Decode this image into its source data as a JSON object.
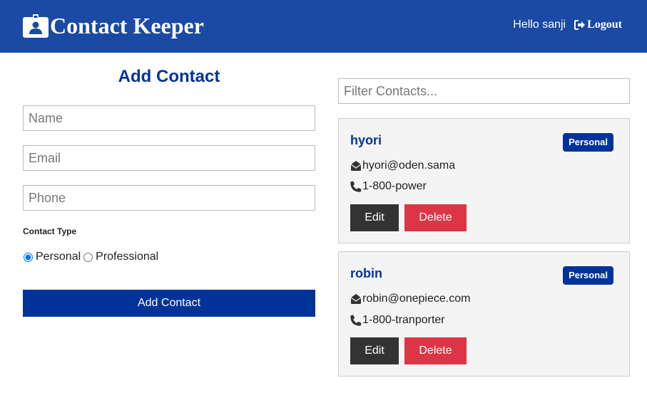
{
  "navbar": {
    "brand_icon": "id-badge-icon",
    "title": "Contact Keeper",
    "greeting": "Hello sanji",
    "logout_label": "Logout",
    "logout_icon": "sign-out-icon",
    "background": "#1a4aa3"
  },
  "form": {
    "title": "Add Contact",
    "name_placeholder": "Name",
    "email_placeholder": "Email",
    "phone_placeholder": "Phone",
    "contact_type_label": "Contact Type",
    "type_options": [
      "Personal",
      "Professional"
    ],
    "selected_type": "Personal",
    "submit_label": "Add Contact",
    "accent": "#003399"
  },
  "filter": {
    "placeholder": "Filter Contacts..."
  },
  "contacts": [
    {
      "name": "hyori",
      "type": "Personal",
      "email": "hyori@oden.sama",
      "phone": "1-800-power",
      "edit_label": "Edit",
      "delete_label": "Delete"
    },
    {
      "name": "robin",
      "type": "Personal",
      "email": "robin@onepiece.com",
      "phone": "1-800-tranporter",
      "edit_label": "Edit",
      "delete_label": "Delete"
    }
  ]
}
